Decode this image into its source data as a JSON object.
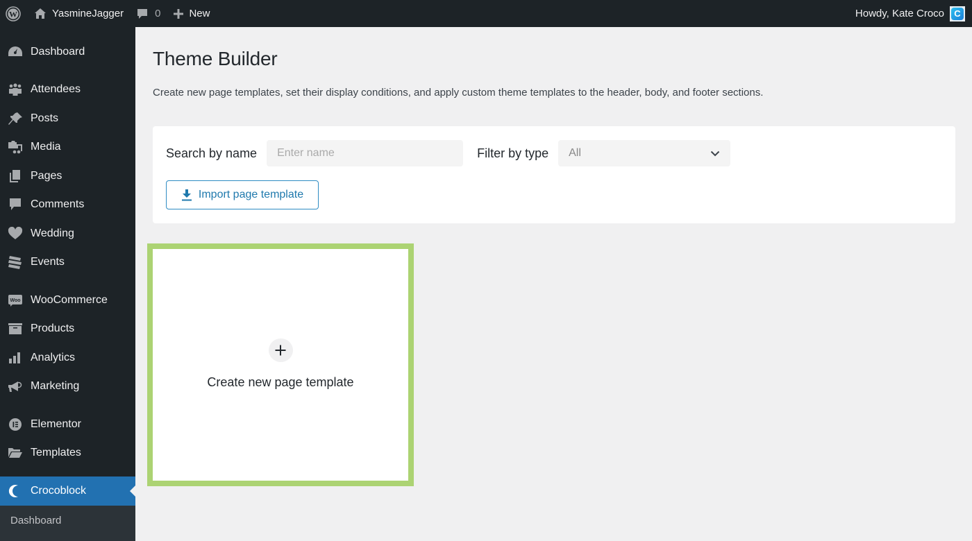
{
  "admin_bar": {
    "site_name": "YasmineJagger",
    "comments_count": "0",
    "new_label": "New",
    "howdy": "Howdy, Kate Croco",
    "avatar_letter": "C"
  },
  "sidebar": {
    "items": [
      {
        "label": "Dashboard",
        "icon": "dashboard-icon"
      },
      {
        "label": "Attendees",
        "icon": "attendees-icon"
      },
      {
        "label": "Posts",
        "icon": "pin-icon"
      },
      {
        "label": "Media",
        "icon": "media-icon"
      },
      {
        "label": "Pages",
        "icon": "pages-icon"
      },
      {
        "label": "Comments",
        "icon": "comment-icon"
      },
      {
        "label": "Wedding",
        "icon": "heart-icon"
      },
      {
        "label": "Events",
        "icon": "tickets-icon"
      },
      {
        "label": "WooCommerce",
        "icon": "woo-icon"
      },
      {
        "label": "Products",
        "icon": "archive-icon"
      },
      {
        "label": "Analytics",
        "icon": "bar-chart-icon"
      },
      {
        "label": "Marketing",
        "icon": "megaphone-icon"
      },
      {
        "label": "Elementor",
        "icon": "elementor-icon"
      },
      {
        "label": "Templates",
        "icon": "folder-icon"
      },
      {
        "label": "Crocoblock",
        "icon": "crocoblock-icon",
        "active": true
      }
    ],
    "submenu": [
      {
        "label": "Dashboard"
      }
    ]
  },
  "main": {
    "title": "Theme Builder",
    "description": "Create new page templates, set their display conditions, and apply custom theme templates to the header, body, and footer sections.",
    "filters": {
      "search_label": "Search by name",
      "search_placeholder": "Enter name",
      "search_value": "",
      "type_label": "Filter by type",
      "type_value": "All"
    },
    "import_button": "Import page template",
    "create_card": {
      "label": "Create new page template"
    }
  },
  "colors": {
    "accent": "#2271b1",
    "highlight_border": "#acd373",
    "admin_bar_bg": "#1d2327"
  }
}
